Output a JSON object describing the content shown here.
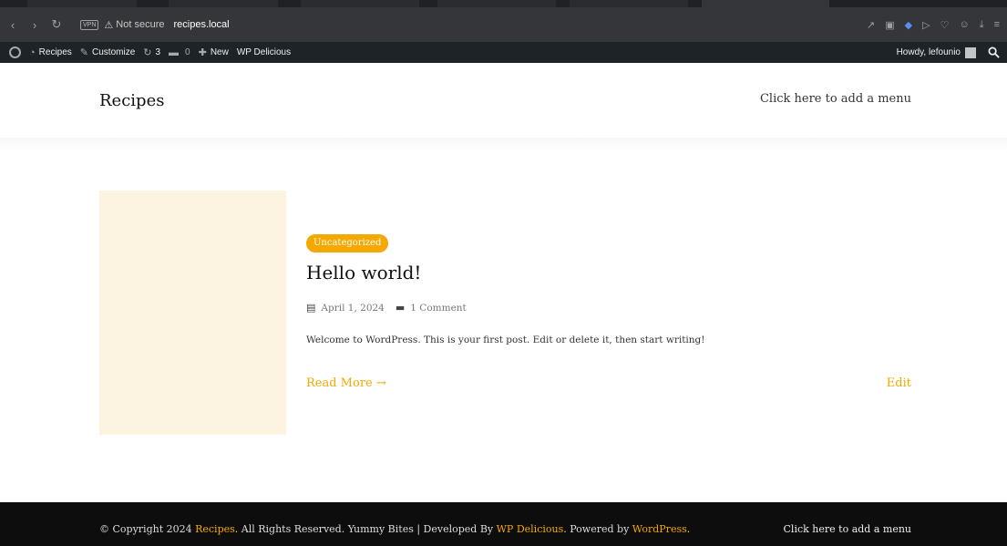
{
  "browser": {
    "vpn_label": "VPN",
    "security_label": "Not secure",
    "url": "recipes.local"
  },
  "adminbar": {
    "site_label": "Recipes",
    "customize_label": "Customize",
    "updates_count": "3",
    "comments_count": "0",
    "new_label": "New",
    "plugin_label": "WP Delicious",
    "howdy_label": "Howdy, lefounio"
  },
  "header": {
    "site_title": "Recipes",
    "menu_placeholder": "Click here to add a menu"
  },
  "post": {
    "category": "Uncategorized",
    "title": "Hello world!",
    "date": "April 1, 2024",
    "comments": "1 Comment",
    "excerpt": "Welcome to WordPress. This is your first post. Edit or delete it, then start writing!",
    "read_more": "Read More →",
    "edit": "Edit"
  },
  "footer": {
    "copyright_prefix": "© Copyright 2024 ",
    "site_link": "Recipes",
    "middle_text": ". All Rights Reserved. Yummy Bites | Developed By ",
    "developer_link": "WP Delicious",
    "powered_text": ". Powered by ",
    "powered_link": "WordPress",
    "end_text": ".",
    "menu_placeholder": "Click here to add a menu"
  },
  "colors": {
    "accent": "#f5a800",
    "thumbnail_bg": "#fdf3e1",
    "adminbar_bg": "#1d2327",
    "footer_bg": "#0d0d0d"
  }
}
